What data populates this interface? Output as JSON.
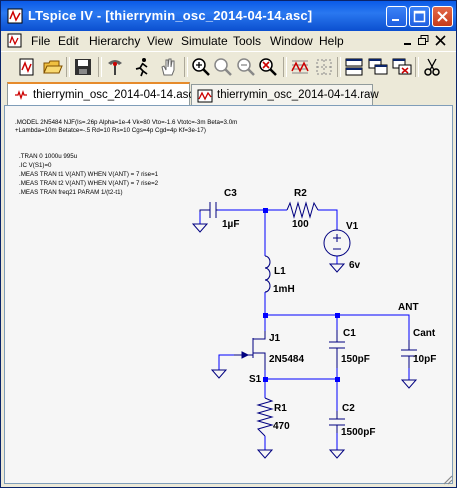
{
  "window": {
    "title": "LTspice IV - [thierrymin_osc_2014-04-14.asc]"
  },
  "menu": [
    "File",
    "Edit",
    "Hierarchy",
    "View",
    "Simulate",
    "Tools",
    "Window",
    "Help"
  ],
  "toolbar_icons": [
    "new-schematic-icon",
    "open-icon",
    "save-icon",
    "control-panel-icon",
    "run-icon",
    "halt-icon",
    "zoom-in-icon",
    "zoom-pan-icon",
    "zoom-out-icon",
    "zoom-cancel-icon",
    "autorange-icon",
    "grid-icon",
    "tile-horizontal-icon",
    "cascade-icon",
    "close-all-icon",
    "cut-icon"
  ],
  "tabs": [
    {
      "label": "thierrymin_osc_2014-04-14.asc",
      "icon": "schematic-icon",
      "active": true
    },
    {
      "label": "thierrymin_osc_2014-04-14.raw",
      "icon": "waveform-icon",
      "active": false
    }
  ],
  "schematic": {
    "model_line1": ".MODEL 2N5484 NJF(Is=.26p Alpha=1e-4 Vk=80 Vto=-1.6 Vtotc=-3m Beta=3.0m",
    "model_line2": "+Lambda=10m Betatce=-.5 Rd=10 Rs=10 Cgs=4p Cgd=4p Kf=3e-17)",
    "tran": ".TRAN 0 1000u 995u",
    "ic": ".IC V(S1)=0",
    "meas1": ".MEAS TRAN t1 V(ANT) WHEN V(ANT) = 7 rise=1",
    "meas2": ".MEAS TRAN t2 V(ANT) WHEN V(ANT) = 7 rise=2",
    "meas3": ".MEAS TRAN freq21 PARAM 1/(t2-t1)",
    "c3_name": "C3",
    "c3_value": "1µF",
    "r2_name": "R2",
    "r2_value": "100",
    "v1_name": "V1",
    "v1_value": "6v",
    "l1_name": "L1",
    "l1_value": "1mH",
    "ant_label": "ANT",
    "j1_name": "J1",
    "j1_value": "2N5484",
    "c1_name": "C1",
    "c1_value": "150pF",
    "cant_name": "Cant",
    "cant_value": "10pF",
    "s1_label": "S1",
    "r1_name": "R1",
    "r1_value": "470",
    "c2_name": "C2",
    "c2_value": "1500pF"
  },
  "colors": {
    "wire": "#0000ff",
    "component": "#000080",
    "title_bar": "#0a5ae8"
  }
}
